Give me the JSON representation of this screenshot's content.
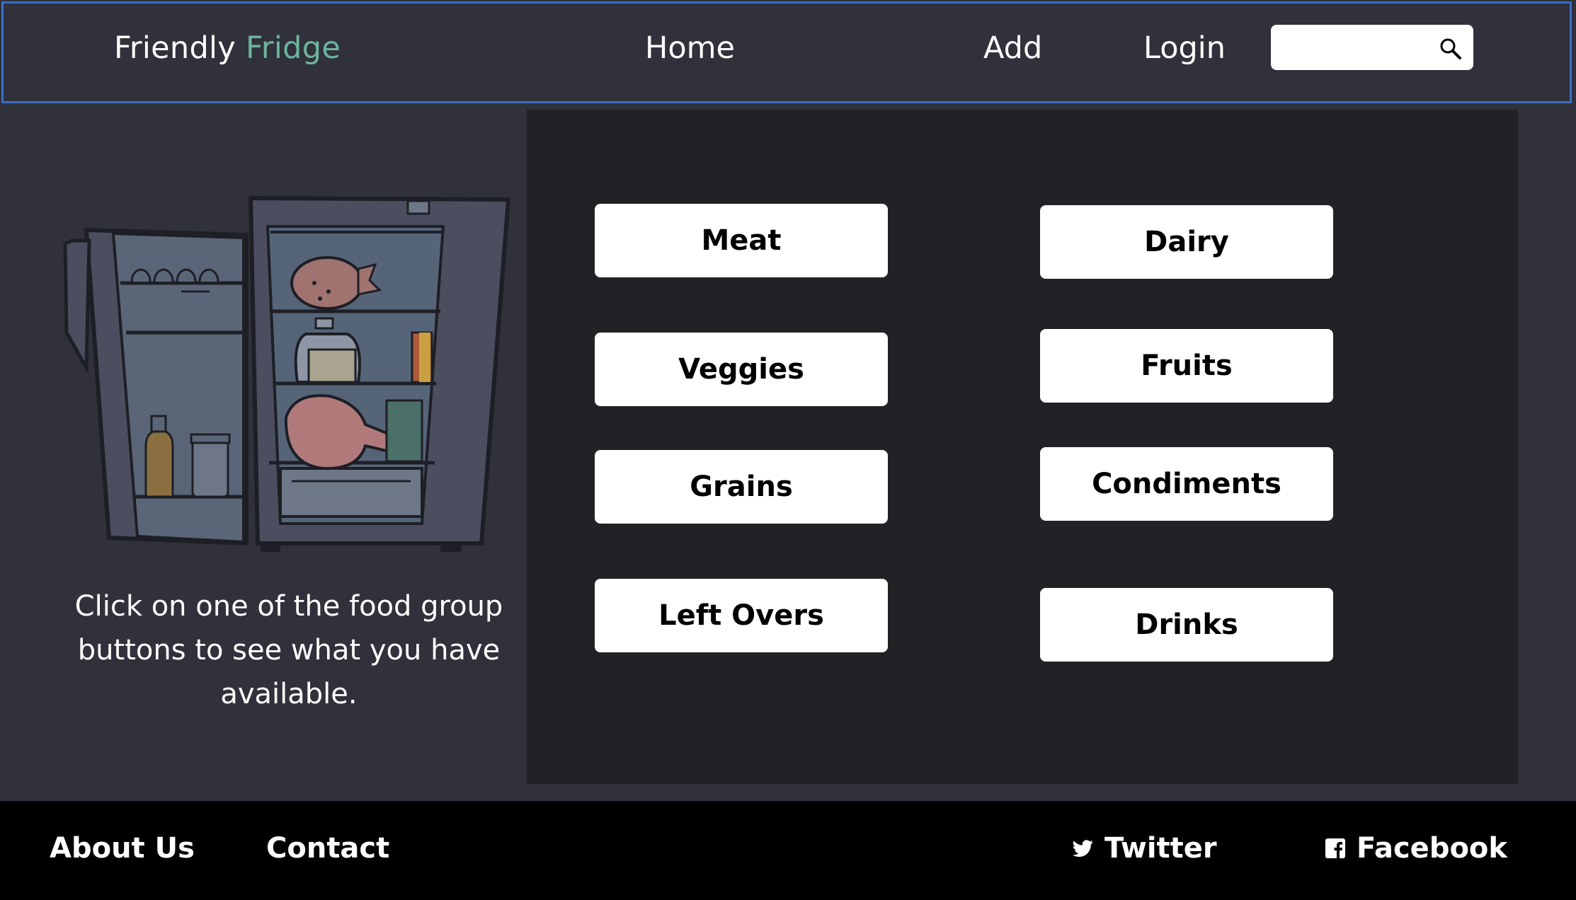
{
  "nav": {
    "brand_main": "Friendly",
    "brand_accent": "Fridge",
    "links": [
      "Home",
      "Add",
      "Login"
    ],
    "search_placeholder": ""
  },
  "main": {
    "intro_text": "Click on one of the food group buttons to see what you have available.",
    "food_groups": [
      "Meat",
      "Dairy",
      "Veggies",
      "Fruits",
      "Grains",
      "Condiments",
      "Left Overs",
      "Drinks"
    ]
  },
  "footer": {
    "about": "About Us",
    "contact": "Contact",
    "twitter": "Twitter",
    "facebook": "Facebook"
  },
  "colors": {
    "background": "#30313b",
    "panel": "#222226",
    "accent": "#6db39c",
    "nav_border": "#3b6fc4",
    "footer": "#000000"
  }
}
